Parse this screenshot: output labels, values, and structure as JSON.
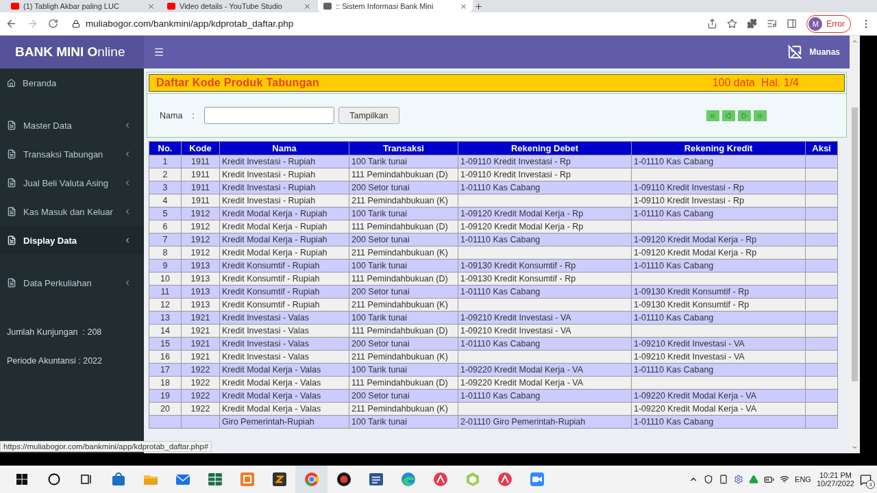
{
  "browser": {
    "tabs": [
      {
        "title": "(1) Tabligh Akbar paling LUC",
        "selected": false
      },
      {
        "title": "Video details - YouTube Studio",
        "selected": false
      },
      {
        "title": ":: Sistem Informasi Bank Mini",
        "selected": true
      }
    ],
    "url": "muliabogor.com/bankmini/app/kdprotab_daftar.php",
    "profile_initial": "M",
    "profile_status": "Error"
  },
  "header": {
    "logo": "**BANK MINI O**nline",
    "user": "Muanas"
  },
  "sidebar": {
    "items": [
      {
        "label": "Beranda",
        "kind": "home",
        "selected": false
      },
      {
        "label": "Master Data",
        "kind": "menu",
        "selected": false
      },
      {
        "label": "Transaksi Tabungan",
        "kind": "menu",
        "selected": false
      },
      {
        "label": "Jual Beli Valuta Asing",
        "kind": "menu",
        "selected": false
      },
      {
        "label": "Kas Masuk dan Keluar",
        "kind": "menu",
        "selected": false
      },
      {
        "label": "Display Data",
        "kind": "menu",
        "selected": true
      },
      {
        "label": "Data Perkuliahan",
        "kind": "menu",
        "selected": false
      }
    ],
    "info": [
      "Jumlah Kunjungan  : 208",
      "Periode Akuntansi : 2022"
    ]
  },
  "panel": {
    "title": "Daftar Kode Produk Tabungan",
    "summary": "100 data  Hal. 1/4",
    "filter_label": "Nama",
    "filter_colon": ":",
    "button": "Tampilkan"
  },
  "table": {
    "columns": [
      "No.",
      "Kode",
      "Nama",
      "Transaksi",
      "Rekening Debet",
      "Rekening Kredit",
      "Aksi"
    ],
    "rows": [
      {
        "no": "1",
        "kode": "1911",
        "nama": "Kredit Investasi - Rupiah",
        "transaksi": "100 Tarik tunai",
        "debet": "1-09110 Kredit Investasi - Rp",
        "kredit": "1-01110 Kas Cabang"
      },
      {
        "no": "2",
        "kode": "1911",
        "nama": "Kredit Investasi - Rupiah",
        "transaksi": "111 Pemindahbukuan (D)",
        "debet": "1-09110 Kredit Investasi - Rp"
      },
      {
        "no": "3",
        "kode": "1911",
        "nama": "Kredit Investasi - Rupiah",
        "transaksi": "200 Setor tunai",
        "debet": "1-01110 Kas Cabang",
        "kredit": "1-09110 Kredit Investasi - Rp"
      },
      {
        "no": "4",
        "kode": "1911",
        "nama": "Kredit Investasi - Rupiah",
        "transaksi": "211 Pemindahbukuan (K)",
        "kredit": "1-09110 Kredit Investasi - Rp"
      },
      {
        "no": "5",
        "kode": "1912",
        "nama": "Kredit Modal Kerja - Rupiah",
        "transaksi": "100 Tarik tunai",
        "debet": "1-09120 Kredit Modal Kerja - Rp",
        "kredit": "1-01110 Kas Cabang"
      },
      {
        "no": "6",
        "kode": "1912",
        "nama": "Kredit Modal Kerja - Rupiah",
        "transaksi": "111 Pemindahbukuan (D)",
        "debet": "1-09120 Kredit Modal Kerja - Rp"
      },
      {
        "no": "7",
        "kode": "1912",
        "nama": "Kredit Modal Kerja - Rupiah",
        "transaksi": "200 Setor tunai",
        "debet": "1-01110 Kas Cabang",
        "kredit": "1-09120 Kredit Modal Kerja - Rp"
      },
      {
        "no": "8",
        "kode": "1912",
        "nama": "Kredit Modal Kerja - Rupiah",
        "transaksi": "211 Pemindahbukuan (K)",
        "kredit": "1-09120 Kredit Modal Kerja - Rp"
      },
      {
        "no": "9",
        "kode": "1913",
        "nama": "Kredit Konsumtif - Rupiah",
        "transaksi": "100 Tarik tunai",
        "debet": "1-09130 Kredit Konsumtif - Rp",
        "kredit": "1-01110 Kas Cabang"
      },
      {
        "no": "10",
        "kode": "1913",
        "nama": "Kredit Konsumtif - Rupiah",
        "transaksi": "111 Pemindahbukuan (D)",
        "debet": "1-09130 Kredit Konsumtif - Rp"
      },
      {
        "no": "11",
        "kode": "1913",
        "nama": "Kredit Konsumtif - Rupiah",
        "transaksi": "200 Setor tunai",
        "debet": "1-01110 Kas Cabang",
        "kredit": "1-09130 Kredit Konsumtif - Rp"
      },
      {
        "no": "12",
        "kode": "1913",
        "nama": "Kredit Konsumtif - Rupiah",
        "transaksi": "211 Pemindahbukuan (K)",
        "kredit": "1-09130 Kredit Konsumtif - Rp"
      },
      {
        "no": "13",
        "kode": "1921",
        "nama": "Kredit Investasi - Valas",
        "transaksi": "100 Tarik tunai",
        "debet": "1-09210 Kredit Investasi - VA",
        "kredit": "1-01110 Kas Cabang"
      },
      {
        "no": "14",
        "kode": "1921",
        "nama": "Kredit Investasi - Valas",
        "transaksi": "111 Pemindahbukuan (D)",
        "debet": "1-09210 Kredit Investasi - VA"
      },
      {
        "no": "15",
        "kode": "1921",
        "nama": "Kredit Investasi - Valas",
        "transaksi": "200 Setor tunai",
        "debet": "1-01110 Kas Cabang",
        "kredit": "1-09210 Kredit Investasi - VA"
      },
      {
        "no": "16",
        "kode": "1921",
        "nama": "Kredit Investasi - Valas",
        "transaksi": "211 Pemindahbukuan (K)",
        "kredit": "1-09210 Kredit Investasi - VA"
      },
      {
        "no": "17",
        "kode": "1922",
        "nama": "Kredit Modal Kerja - Valas",
        "transaksi": "100 Tarik tunai",
        "debet": "1-09220 Kredit Modal Kerja - VA",
        "kredit": "1-01110 Kas Cabang"
      },
      {
        "no": "18",
        "kode": "1922",
        "nama": "Kredit Modal Kerja - Valas",
        "transaksi": "111 Pemindahbukuan (D)",
        "debet": "1-09220 Kredit Modal Kerja - VA"
      },
      {
        "no": "19",
        "kode": "1922",
        "nama": "Kredit Modal Kerja - Valas",
        "transaksi": "200 Setor tunai",
        "debet": "1-01110 Kas Cabang",
        "kredit": "1-09220 Kredit Modal Kerja - VA"
      },
      {
        "no": "20",
        "kode": "1922",
        "nama": "Kredit Modal Kerja - Valas",
        "transaksi": "211 Pemindahbukuan (K)",
        "kredit": "1-09220 Kredit Modal Kerja - VA"
      },
      {
        "nama": "Giro Pemerintah-Rupiah",
        "transaksi": "100 Tarik tunai",
        "debet": "2-01110 Giro Pemerintah-Rupiah",
        "kredit": "1-01110 Kas Cabang"
      }
    ]
  },
  "status_url": "https://muliabogor.com/bankmini/app/kdprotab_daftar.php#",
  "taskbar": {
    "language": "ENG",
    "time": "10:21 PM",
    "date": "10/27/2022",
    "notifications": "3"
  }
}
